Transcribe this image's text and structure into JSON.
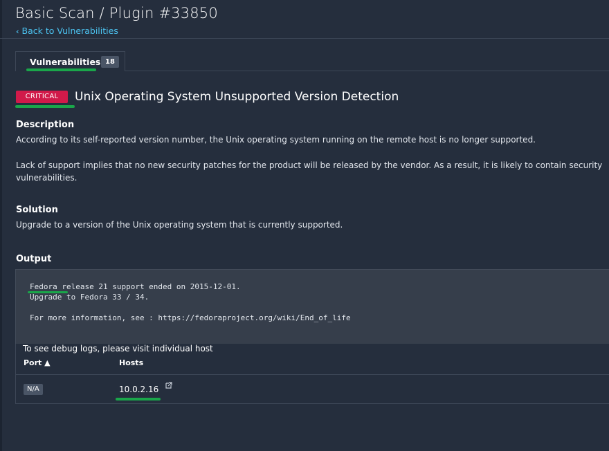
{
  "page": {
    "title": "Basic Scan / Plugin #33850",
    "back_link": "Back to Vulnerabilities"
  },
  "tabs": [
    {
      "label": "Vulnerabilities",
      "count": "18"
    }
  ],
  "vulnerability": {
    "severity": "CRITICAL",
    "title": "Unix Operating System Unsupported Version Detection"
  },
  "description": {
    "heading": "Description",
    "paragraphs": [
      "According to its self-reported version number, the Unix operating system running on the remote host is no longer supported.",
      "Lack of support implies that no new security patches for the product will be released by the vendor. As a result, it is likely to contain security vulnerabilities."
    ]
  },
  "solution": {
    "heading": "Solution",
    "text": "Upgrade to a version of the Unix operating system that is currently supported."
  },
  "output": {
    "heading": "Output",
    "lines": [
      "Fedora release 21 support ended on 2015-12-01.",
      "Upgrade to Fedora 33 / 34.",
      "",
      "For more information, see : https://fedoraproject.org/wiki/End_of_life"
    ]
  },
  "hosts_table": {
    "debug_note": "To see debug logs, please visit individual host",
    "columns": {
      "port": "Port ▲",
      "hosts": "Hosts"
    },
    "rows": [
      {
        "port": "N/A",
        "host": "10.0.2.16"
      }
    ]
  },
  "colors": {
    "background": "#252e3d",
    "critical": "#d11a4a",
    "link": "#4cc3f0",
    "highlight_underline": "#1aa64a"
  }
}
